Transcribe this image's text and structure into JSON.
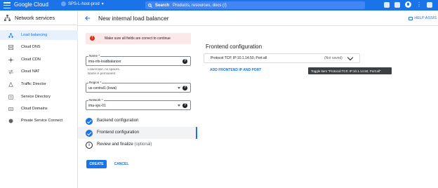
{
  "topbar": {
    "logo": "Google Cloud",
    "project": "SPS-L-host-prod",
    "search_label": "Search",
    "search_placeholder": "Products, resources, docs (/)"
  },
  "leftnav": {
    "title": "Network services",
    "items": [
      {
        "label": "Load balancing",
        "icon": "load-balancing-icon",
        "active": true
      },
      {
        "label": "Cloud DNS",
        "icon": "dns-icon"
      },
      {
        "label": "Cloud CDN",
        "icon": "cdn-icon"
      },
      {
        "label": "Cloud NAT",
        "icon": "nat-icon"
      },
      {
        "label": "Traffic Director",
        "icon": "traffic-director-icon"
      },
      {
        "label": "Service Directory",
        "icon": "service-directory-icon"
      },
      {
        "label": "Cloud Domains",
        "icon": "domains-icon"
      },
      {
        "label": "Private Service Connect",
        "icon": "psc-icon"
      }
    ]
  },
  "page": {
    "title": "New internal load balancer",
    "help": "HELP ASSIS"
  },
  "form": {
    "error": "Make sure all fields are correct to continue",
    "name": {
      "label": "Name *",
      "value": "ima-nfs-loadbalancer",
      "hint_1": "Lowercase, no spaces.",
      "hint_2": "Name is permanent"
    },
    "region": {
      "label": "Region *",
      "value": "us-central1 (Iowa)"
    },
    "network": {
      "label": "Network *",
      "value": "ima-vpc-01"
    },
    "steps": [
      {
        "label": "Backend configuration",
        "state": "done"
      },
      {
        "label": "Frontend configuration",
        "state": "done"
      },
      {
        "label": "Review and finalize",
        "optional": "(optional)",
        "state": "pending"
      }
    ],
    "create_label": "CREATE",
    "cancel_label": "CANCEL"
  },
  "frontend": {
    "title": "Frontend configuration",
    "item_text": "Protocol:TCP, IP:10.1.14.50, Port:all",
    "item_status": "(Not saved)",
    "add_label": "ADD FRONTEND IP AND PORT",
    "tooltip": "Toggle item \"Protocol:TCP, IP:10.1.14.50, Port:all\""
  }
}
